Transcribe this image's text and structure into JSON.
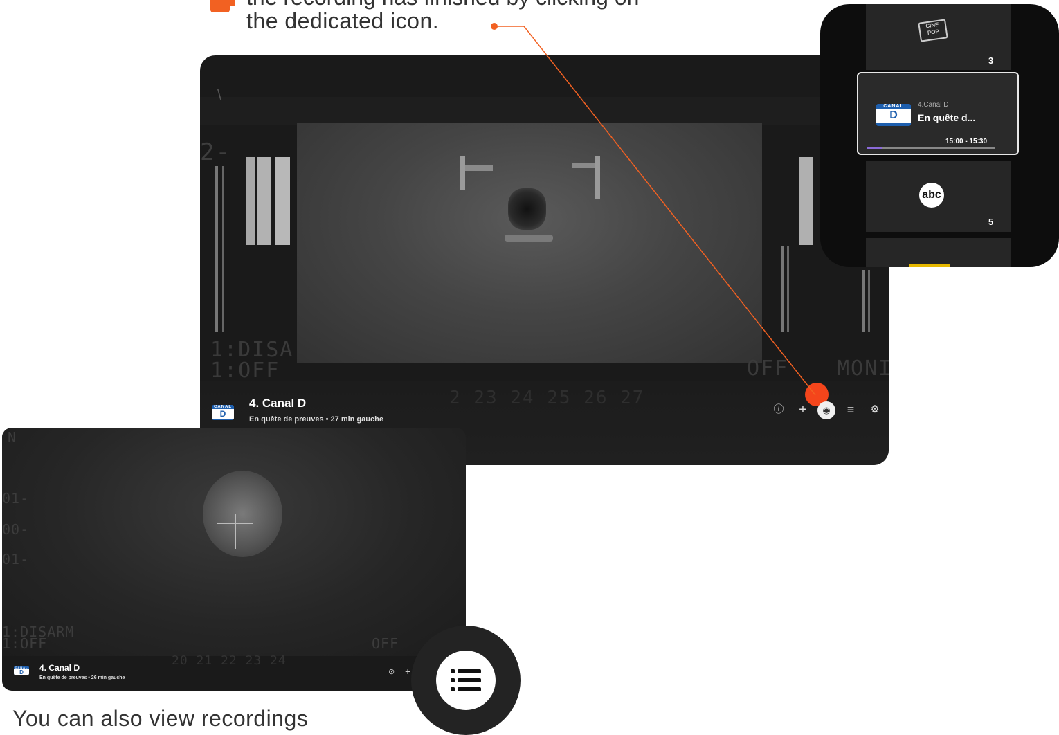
{
  "top_caption": {
    "line1": "the recording has finished by clicking on",
    "line2": "the dedicated icon."
  },
  "bottom_caption": "You can also view recordings",
  "main_player": {
    "logo_text": "CANAL",
    "logo_letter": "D",
    "channel": "4. Canal D",
    "subtitle": "En quête de preuves  •  27 min gauche",
    "hud_left_1": "1:DISA",
    "hud_left_2": "1:OFF",
    "hud_bottom": "2 23 24 25 26 27",
    "hud_right_1": "OFF",
    "hud_right_2": "MONI",
    "hud_num": "2-",
    "controls": {
      "info_icon": "ⓘ",
      "add_icon": "+",
      "record_icon": "◉",
      "list_icon": "≡",
      "settings_icon": "⚙"
    },
    "accent_color": "#f4451b"
  },
  "guide": {
    "top_logo": "CINE POP",
    "top_number": "3",
    "card": {
      "logo_text": "CANAL",
      "logo_letter": "D",
      "channel": "4.Canal D",
      "title": "En quête d...",
      "time": "15:00 - 15:30",
      "progress": 0.12
    },
    "bottom_logo": "abc",
    "bottom_number": "5"
  },
  "small_player": {
    "logo_text": "CANAL",
    "logo_letter": "D",
    "channel": "4. Canal D",
    "subtitle": "En quête de preuves  •  26 min gauche",
    "hud_left_1": "1:DISARM",
    "hud_left_2": "1:OFF",
    "hud_left_3": "01-",
    "hud_left_4": "00-",
    "hud_left_5": "01-",
    "hud_bottom": "20 21 22 23 24",
    "hud_right": "OFF",
    "hud_top": "N",
    "controls": {
      "info_icon": "⊙",
      "add_icon": "+"
    }
  }
}
